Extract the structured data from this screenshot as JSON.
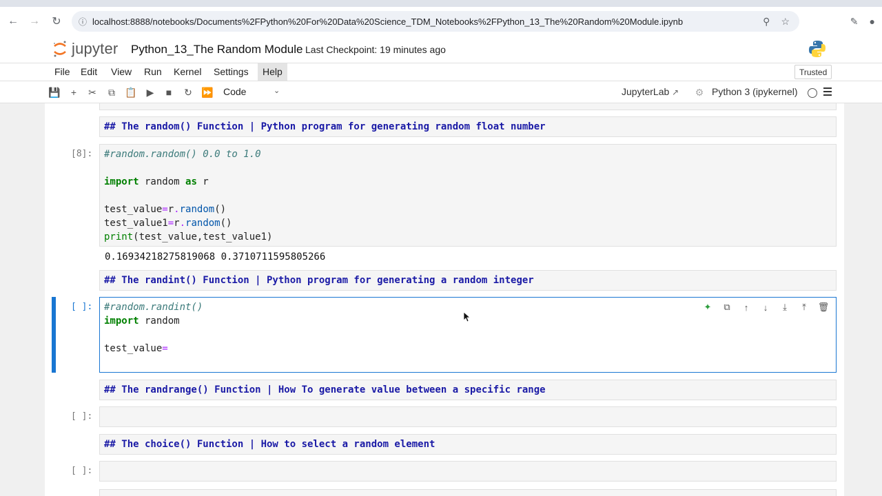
{
  "browser": {
    "url": "localhost:8888/notebooks/Documents%2FPython%20For%20Data%20Science_TDM_Notebooks%2FPython_13_The%20Random%20Module.ipynb",
    "icons": [
      "back-icon",
      "forward-icon",
      "reload-icon",
      "site-info-icon",
      "zoom-icon",
      "bookmark-icon",
      "extensions-icon",
      "profile-icon"
    ]
  },
  "header": {
    "logo_text": "jupyter",
    "notebook_title": "Python_13_The Random Module",
    "checkpoint": "Last Checkpoint: 19 minutes ago"
  },
  "menu": {
    "items": [
      "File",
      "Edit",
      "View",
      "Run",
      "Kernel",
      "Settings",
      "Help"
    ],
    "active": "Help",
    "trusted": "Trusted"
  },
  "toolbar": {
    "cell_type": "Code",
    "jupyterlab_link": "JupyterLab",
    "kernel": "Python 3 (ipykernel)"
  },
  "cells": {
    "md1": "## The random() Function | Python program for generating random float number",
    "c1_prompt": "[8]:",
    "c1_comment": "#random.random() 0.0 to 1.0",
    "c1_out": "0.16934218275819068 0.3710711595805266",
    "md2": "## The randint() Function | Python program for generating a random integer",
    "c2_prompt": "[ ]:",
    "c2_comment": "#random.randint()",
    "md3": "## The randrange() Function | How To generate value between a specific range",
    "c3_prompt": "[ ]:",
    "md4": "## The choice() Function | How to select a random element",
    "c4_prompt": "[ ]:"
  },
  "colors": {
    "accent": "#1976d2",
    "markdown_heading": "#1a1aa6",
    "keyword": "#008000",
    "comment": "#3b7a7a"
  }
}
